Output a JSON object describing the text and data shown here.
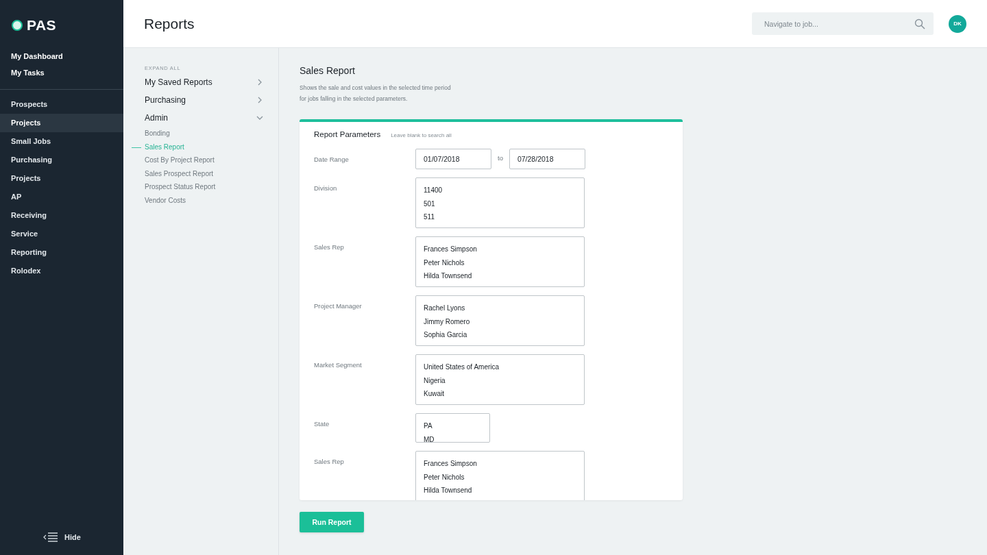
{
  "app": {
    "logo": "PAS"
  },
  "sidebar": {
    "primary": [
      {
        "label": "My Dashboard",
        "selected": false
      },
      {
        "label": "My Tasks",
        "selected": false
      }
    ],
    "items": [
      {
        "label": "Prospects",
        "selected": false
      },
      {
        "label": "Projects",
        "selected": true
      },
      {
        "label": "Small Jobs",
        "selected": false
      },
      {
        "label": "Purchasing",
        "selected": false
      },
      {
        "label": "Projects",
        "selected": false
      },
      {
        "label": "AP",
        "selected": false
      },
      {
        "label": "Receiving",
        "selected": false
      },
      {
        "label": "Service",
        "selected": false
      },
      {
        "label": "Reporting",
        "selected": false
      },
      {
        "label": "Rolodex",
        "selected": false
      }
    ],
    "hide_label": "Hide"
  },
  "header": {
    "title": "Reports",
    "search": {
      "placeholder": "Navigate to job..."
    },
    "avatar": "DK"
  },
  "reports_nav": {
    "expand_all": "EXPAND ALL",
    "sections": [
      {
        "label": "My Saved Reports",
        "expanded": false
      },
      {
        "label": "Purchasing",
        "expanded": false
      },
      {
        "label": "Admin",
        "expanded": true,
        "items": [
          {
            "label": "Bonding",
            "selected": false
          },
          {
            "label": "Sales Report",
            "selected": true
          },
          {
            "label": "Cost By Project Report",
            "selected": false
          },
          {
            "label": "Sales Prospect Report",
            "selected": false
          },
          {
            "label": "Prospect Status Report",
            "selected": false
          },
          {
            "label": "Vendor Costs",
            "selected": false
          }
        ]
      }
    ]
  },
  "report": {
    "title": "Sales Report",
    "description": "Shows the sale and cost values in the selected time period\nfor jobs falling in the selected parameters.",
    "panel_title": "Report Parameters",
    "panel_hint": "Leave blank to search all",
    "fields": [
      {
        "label": "Date Range",
        "kind": "daterange",
        "from": "01/07/2018",
        "separator": "to",
        "to": "07/28/2018"
      },
      {
        "label": "Division",
        "kind": "list",
        "options": [
          "11400",
          "501",
          "511"
        ]
      },
      {
        "label": "Sales Rep",
        "kind": "list",
        "options": [
          "Frances Simpson",
          "Peter Nichols",
          "Hilda Townsend"
        ]
      },
      {
        "label": "Project Manager",
        "kind": "list",
        "options": [
          "Rachel Lyons",
          "Jimmy Romero",
          "Sophia Garcia"
        ]
      },
      {
        "label": "Market Segment",
        "kind": "list",
        "options": [
          "United States of America",
          "Nigeria",
          "Kuwait"
        ]
      },
      {
        "label": "State",
        "kind": "shortlist",
        "options": [
          "PA",
          "MD"
        ]
      },
      {
        "label": "Sales Rep",
        "kind": "cutlist",
        "options": [
          "Frances Simpson",
          "Peter Nichols",
          "Hilda Townsend"
        ]
      }
    ],
    "run_button": "Run Report"
  }
}
